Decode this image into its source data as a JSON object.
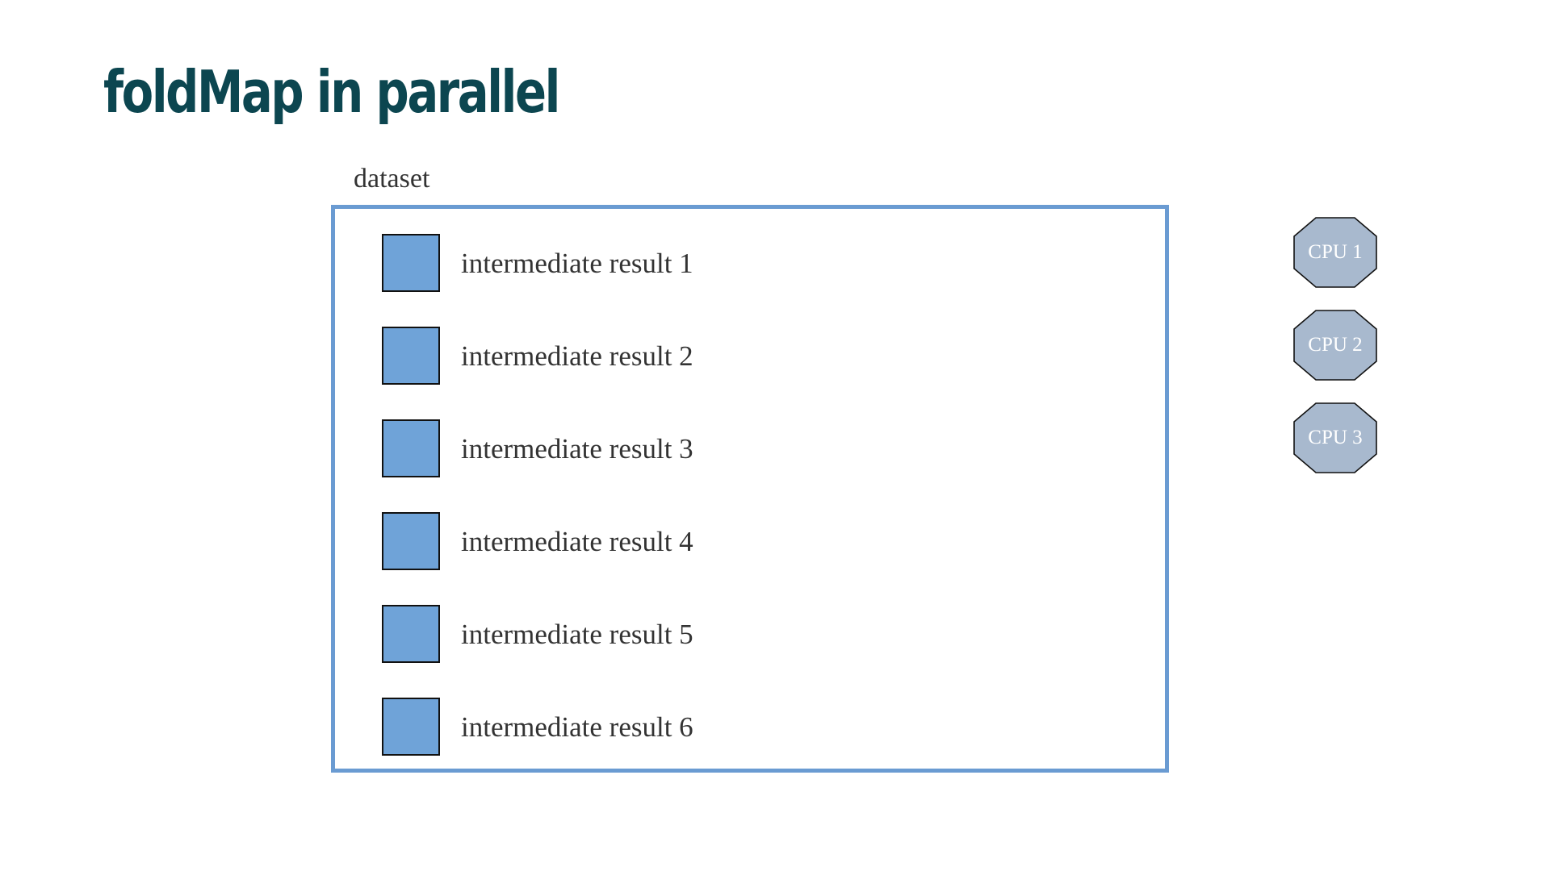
{
  "slide": {
    "title": "foldMap in parallel"
  },
  "dataset": {
    "label": "dataset",
    "items": [
      {
        "label": "intermediate result 1"
      },
      {
        "label": "intermediate result 2"
      },
      {
        "label": "intermediate result 3"
      },
      {
        "label": "intermediate result 4"
      },
      {
        "label": "intermediate result 5"
      },
      {
        "label": "intermediate result 6"
      }
    ]
  },
  "cpus": [
    {
      "label": "CPU 1"
    },
    {
      "label": "CPU 2"
    },
    {
      "label": "CPU 3"
    }
  ],
  "colors": {
    "title": "#0c4650",
    "dataset_border": "#6a9bd2",
    "result_fill": "#6fa3d8",
    "cpu_fill": "#a8b9ce"
  }
}
